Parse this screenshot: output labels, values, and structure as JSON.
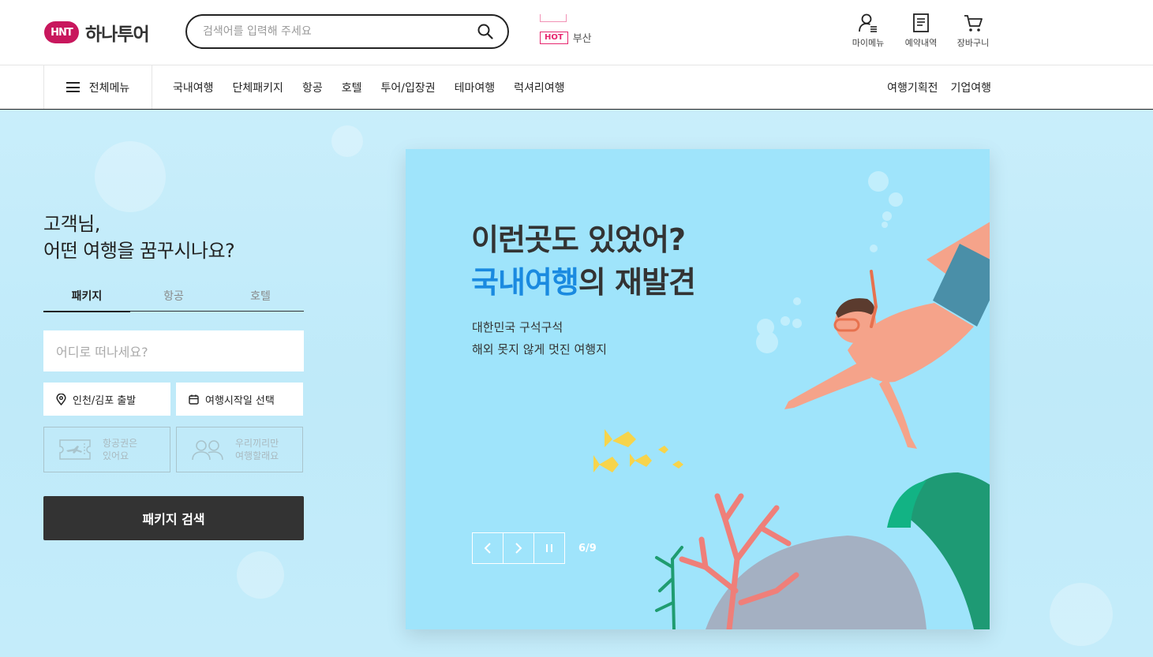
{
  "brand": {
    "mark": "HNT",
    "name": "하나투어",
    "color": "#c8175d"
  },
  "search": {
    "placeholder": "검색어를 입력해 주세요"
  },
  "hot": {
    "badge": "HOT",
    "keyword": "부산"
  },
  "util_menu": [
    {
      "icon": "user-menu-icon",
      "label": "마이메뉴"
    },
    {
      "icon": "document-icon",
      "label": "예약내역"
    },
    {
      "icon": "cart-icon",
      "label": "장바구니"
    }
  ],
  "nav": {
    "all_menu": "전체메뉴",
    "items": [
      "국내여행",
      "단체패키지",
      "항공",
      "호텔",
      "투어/입장권",
      "테마여행",
      "럭셔리여행"
    ],
    "right": [
      "여행기획전",
      "기업여행"
    ]
  },
  "greeting": {
    "line1": "고객님,",
    "line2": "어떤 여행을 꿈꾸시나요?"
  },
  "tabs": [
    {
      "label": "패키지",
      "active": true
    },
    {
      "label": "항공",
      "active": false
    },
    {
      "label": "호텔",
      "active": false
    }
  ],
  "form": {
    "destination_placeholder": "어디로 떠나세요?",
    "departure": "인천/김포 출발",
    "date": "여행시작일 선택",
    "ticket_option": "항공권은\n있어요",
    "group_option": "우리끼리만\n여행할래요",
    "submit": "패키지 검색"
  },
  "banner": {
    "title_line1": "이런곳도 있었어?",
    "title_accent": "국내여행",
    "title_rest": "의 재발견",
    "desc_line1": "대한민국 구석구석",
    "desc_line2": "해외 못지 않게 멋진 여행지",
    "pager": "6/9",
    "accent_color": "#1a8ae0",
    "background": "#9fe4fb"
  }
}
